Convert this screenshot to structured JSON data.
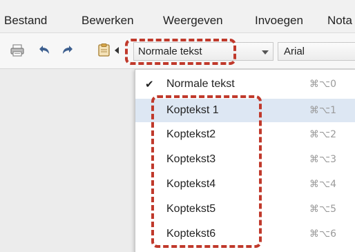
{
  "menubar": {
    "items": [
      "Bestand",
      "Bewerken",
      "Weergeven",
      "Invoegen",
      "Nota"
    ]
  },
  "toolbar": {
    "icons": [
      "print-icon",
      "undo-icon",
      "redo-icon",
      "paint-format-icon"
    ],
    "style_select": {
      "value": "Normale tekst"
    },
    "font_select": {
      "value": "Arial"
    }
  },
  "dropdown": {
    "items": [
      {
        "label": "Normale tekst",
        "shortcut": "⌘⌥0",
        "checked": true
      },
      {
        "label": "Koptekst 1",
        "shortcut": "⌘⌥1",
        "highlighted": true
      },
      {
        "label": "Koptekst2",
        "shortcut": "⌘⌥2"
      },
      {
        "label": "Koptekst3",
        "shortcut": "⌘⌥3"
      },
      {
        "label": "Koptekst4",
        "shortcut": "⌘⌥4"
      },
      {
        "label": "Koptekst5",
        "shortcut": "⌘⌥5"
      },
      {
        "label": "Koptekst6",
        "shortcut": "⌘⌥6"
      }
    ],
    "check_glyph": "✔"
  },
  "colors": {
    "annotation": "#c0392b",
    "highlight": "#dde7f3"
  }
}
